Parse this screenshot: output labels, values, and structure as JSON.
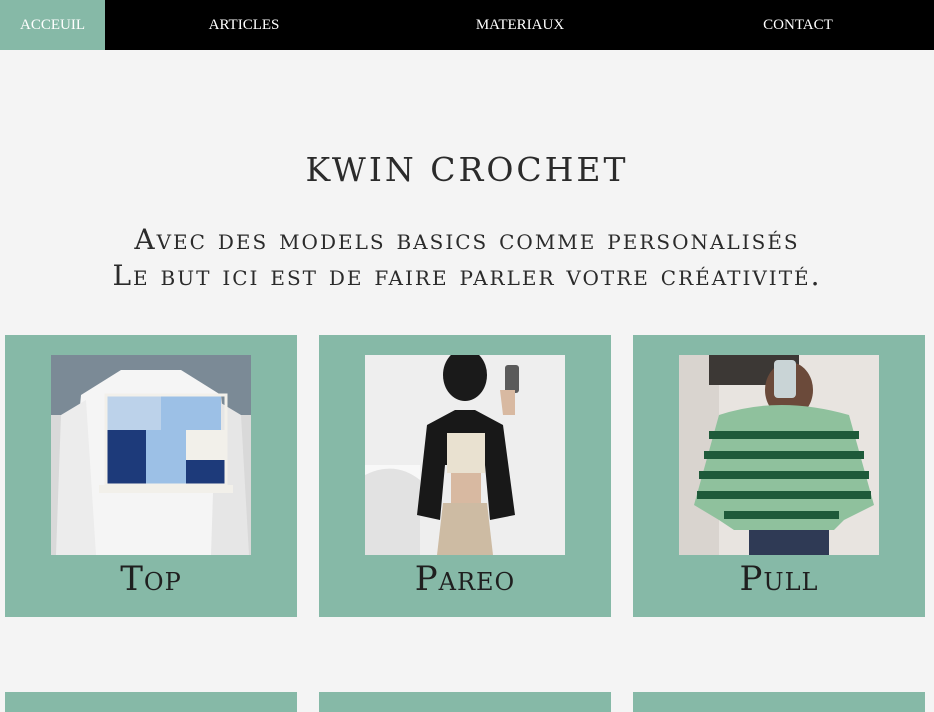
{
  "nav": {
    "items": [
      {
        "label": "ACCEUIL",
        "active": true
      },
      {
        "label": "ARTICLES",
        "active": false
      },
      {
        "label": "MATERIAUX",
        "active": false
      },
      {
        "label": "CONTACT",
        "active": false
      }
    ]
  },
  "hero": {
    "title": "KWIN CROCHET",
    "subtitle_line1": "Avec des models basics comme personalisés",
    "subtitle_line2": "Le but ici est de faire parler votre créativité."
  },
  "cards": [
    {
      "label": "Top"
    },
    {
      "label": "Pareo"
    },
    {
      "label": "Pull"
    }
  ],
  "colors": {
    "accent": "#86b9a7",
    "nav_bg": "#000000",
    "page_bg": "#f4f4f4"
  }
}
